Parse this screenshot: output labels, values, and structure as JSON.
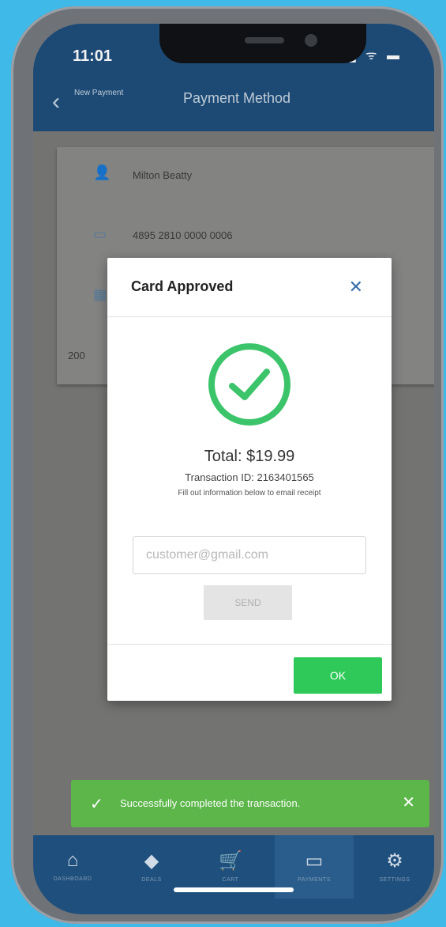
{
  "status": {
    "time": "11:01",
    "icons": "▂▄▆ ᯤ ▬"
  },
  "nav": {
    "back_label": "New Payment",
    "title": "Payment Method"
  },
  "card": {
    "name": "Milton Beatty",
    "number": "4895 2810 0000 0006",
    "partial": "200"
  },
  "modal": {
    "title": "Card Approved",
    "close": "✕",
    "total": "Total: $19.99",
    "transaction": "Transaction ID: 2163401565",
    "hint": "Fill out information below to email receipt",
    "email_placeholder": "customer@gmail.com",
    "send_label": "SEND",
    "ok_label": "OK"
  },
  "toast": {
    "icon": "✓",
    "message": "Successfully completed the transaction.",
    "close": "✕"
  },
  "tabs": [
    {
      "icon": "⌂",
      "label": "DASHBOARD"
    },
    {
      "icon": "◆",
      "label": "DEALS"
    },
    {
      "icon": "🛒",
      "label": "CART"
    },
    {
      "icon": "▭",
      "label": "PAYMENTS"
    },
    {
      "icon": "⚙",
      "label": "SETTINGS"
    }
  ],
  "colors": {
    "accent": "#2ec958",
    "nav": "#1f4f7c",
    "toast": "#5cb64a",
    "background": "#3fb9e8"
  }
}
